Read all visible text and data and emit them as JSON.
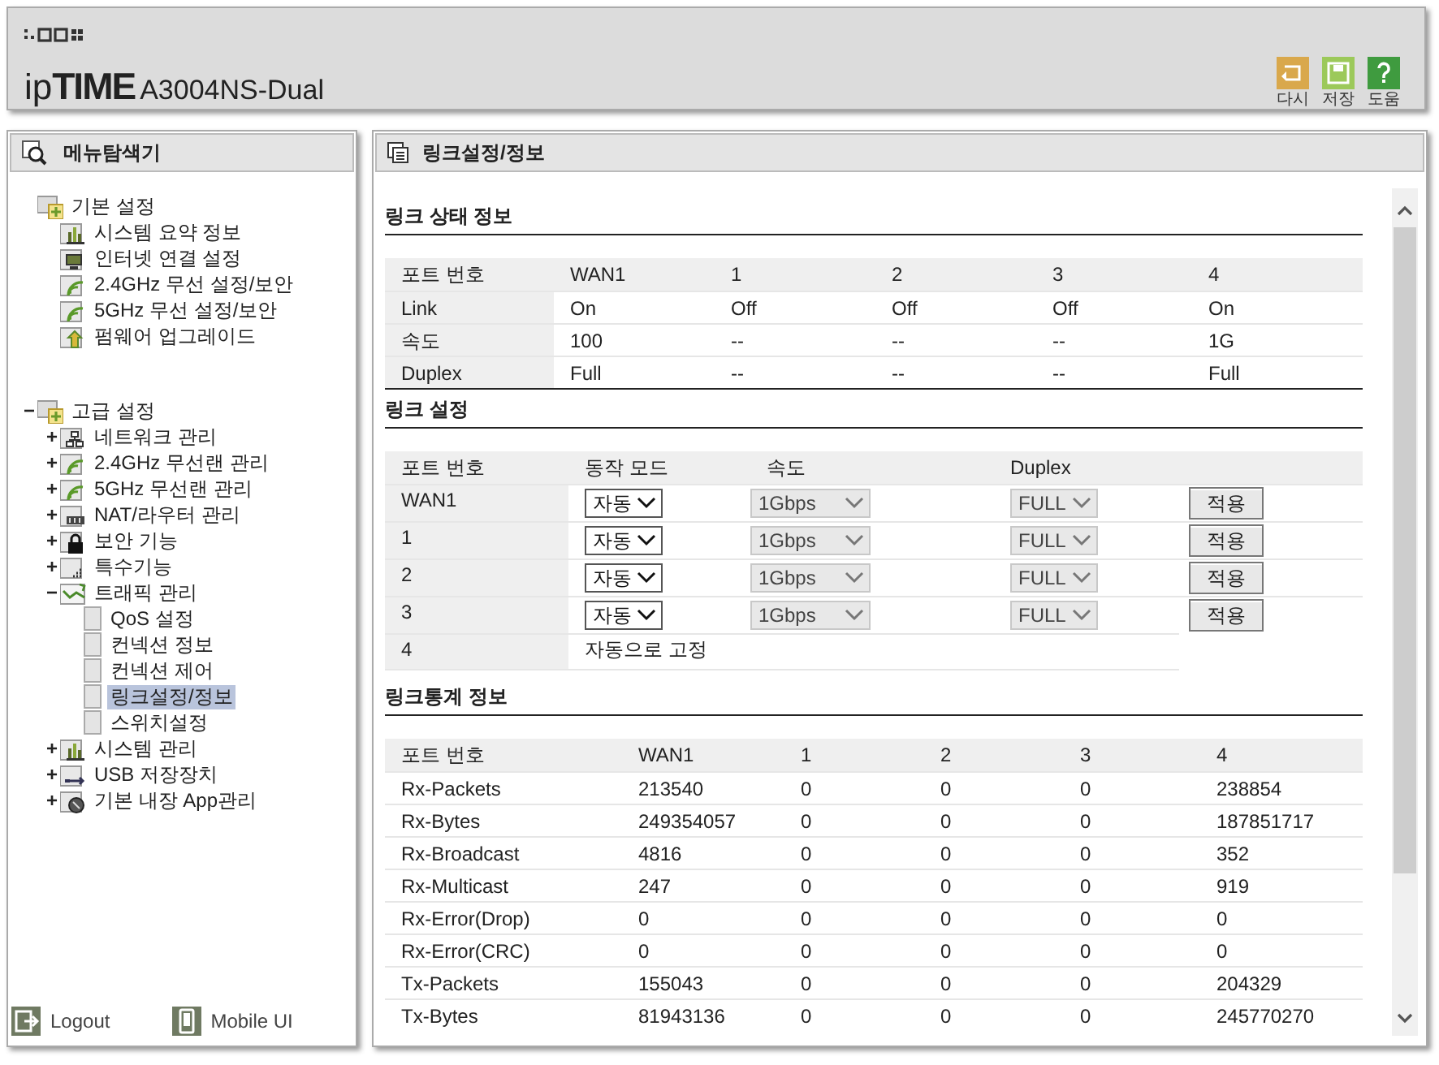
{
  "header": {
    "brand_prefix": "ip",
    "brand": "TIME",
    "model": "A3004NS-Dual",
    "actions": [
      {
        "kind": "undo",
        "label": "다시",
        "color": "#d9a84c"
      },
      {
        "kind": "save",
        "label": "저장",
        "color": "#9cc95a"
      },
      {
        "kind": "help",
        "label": "도움",
        "color": "#3f9b3f"
      }
    ]
  },
  "sidebar": {
    "title": "메뉴탐색기",
    "tree": [
      {
        "label": "기본 설정",
        "kind": "folder",
        "selected": false,
        "children": [
          {
            "label": "시스템 요약 정보",
            "kind": "chart",
            "selected": false
          },
          {
            "label": "인터넷 연결 설정",
            "kind": "monitor",
            "selected": false
          },
          {
            "label": "2.4GHz 무선 설정/보안",
            "kind": "wifi",
            "selected": false
          },
          {
            "label": "5GHz 무선 설정/보안",
            "kind": "wifi",
            "selected": false
          },
          {
            "label": "펌웨어 업그레이드",
            "kind": "upload",
            "selected": false
          }
        ]
      },
      {
        "label": "고급 설정",
        "kind": "folder",
        "toggle": "−",
        "selected": false,
        "children": [
          {
            "label": "네트워크 관리",
            "kind": "network",
            "toggle": "+",
            "selected": false
          },
          {
            "label": "2.4GHz 무선랜 관리",
            "kind": "wifi",
            "toggle": "+",
            "selected": false
          },
          {
            "label": "5GHz 무선랜 관리",
            "kind": "wifi",
            "toggle": "+",
            "selected": false
          },
          {
            "label": "NAT/라우터 관리",
            "kind": "nat",
            "toggle": "+",
            "selected": false
          },
          {
            "label": "보안 기능",
            "kind": "lock",
            "toggle": "+",
            "selected": false
          },
          {
            "label": "특수기능",
            "kind": "special",
            "toggle": "+",
            "selected": false
          },
          {
            "label": "트래픽 관리",
            "kind": "traffic",
            "toggle": "−",
            "selected": false,
            "children": [
              {
                "label": "QoS 설정",
                "kind": "page",
                "selected": false
              },
              {
                "label": "컨넥션 정보",
                "kind": "page",
                "selected": false
              },
              {
                "label": "컨넥션 제어",
                "kind": "page",
                "selected": false
              },
              {
                "label": "링크설정/정보",
                "kind": "page",
                "selected": true
              },
              {
                "label": "스위치설정",
                "kind": "page",
                "selected": false
              }
            ]
          },
          {
            "label": "시스템 관리",
            "kind": "chart",
            "toggle": "+",
            "selected": false
          },
          {
            "label": "USB 저장장치",
            "kind": "usb",
            "toggle": "+",
            "selected": false
          },
          {
            "label": "기본 내장 App관리",
            "kind": "app",
            "toggle": "+",
            "selected": false
          }
        ]
      }
    ],
    "footer": [
      {
        "kind": "logout",
        "label": "Logout"
      },
      {
        "kind": "mobile",
        "label": "Mobile UI"
      }
    ]
  },
  "main": {
    "title": "링크설정/정보",
    "link_status": {
      "title": "링크 상태 정보",
      "columns": [
        "포트 번호",
        "WAN1",
        "1",
        "2",
        "3",
        "4"
      ],
      "rows": [
        [
          "Link",
          "On",
          "Off",
          "Off",
          "Off",
          "On"
        ],
        [
          "속도",
          "100",
          "--",
          "--",
          "--",
          "1G"
        ],
        [
          "Duplex",
          "Full",
          "--",
          "--",
          "--",
          "Full"
        ]
      ]
    },
    "link_settings": {
      "title": "링크 설정",
      "columns": [
        "포트 번호",
        "동작 모드",
        "속도",
        "Duplex"
      ],
      "rows": [
        {
          "port": "WAN1",
          "mode": {
            "value": "자동",
            "disabled": false
          },
          "speed": {
            "value": "1Gbps",
            "disabled": true
          },
          "duplex": {
            "value": "FULL",
            "disabled": true
          },
          "button": "적용"
        },
        {
          "port": "1",
          "mode": {
            "value": "자동",
            "disabled": false
          },
          "speed": {
            "value": "1Gbps",
            "disabled": true
          },
          "duplex": {
            "value": "FULL",
            "disabled": true
          },
          "button": "적용"
        },
        {
          "port": "2",
          "mode": {
            "value": "자동",
            "disabled": false
          },
          "speed": {
            "value": "1Gbps",
            "disabled": true
          },
          "duplex": {
            "value": "FULL",
            "disabled": true
          },
          "button": "적용"
        },
        {
          "port": "3",
          "mode": {
            "value": "자동",
            "disabled": false
          },
          "speed": {
            "value": "1Gbps",
            "disabled": true
          },
          "duplex": {
            "value": "FULL",
            "disabled": true
          },
          "button": "적용"
        },
        {
          "port": "4",
          "note": "자동으로 고정"
        }
      ]
    },
    "link_stats": {
      "title": "링크통계 정보",
      "columns": [
        "포트 번호",
        "WAN1",
        "1",
        "2",
        "3",
        "4"
      ],
      "rows": [
        [
          "Rx-Packets",
          "213540",
          "0",
          "0",
          "0",
          "238854"
        ],
        [
          "Rx-Bytes",
          "249354057",
          "0",
          "0",
          "0",
          "187851717"
        ],
        [
          "Rx-Broadcast",
          "4816",
          "0",
          "0",
          "0",
          "352"
        ],
        [
          "Rx-Multicast",
          "247",
          "0",
          "0",
          "0",
          "919"
        ],
        [
          "Rx-Error(Drop)",
          "0",
          "0",
          "0",
          "0",
          "0"
        ],
        [
          "Rx-Error(CRC)",
          "0",
          "0",
          "0",
          "0",
          "0"
        ],
        [
          "Tx-Packets",
          "155043",
          "0",
          "0",
          "0",
          "204329"
        ],
        [
          "Tx-Bytes",
          "81943136",
          "0",
          "0",
          "0",
          "245770270"
        ]
      ]
    }
  }
}
